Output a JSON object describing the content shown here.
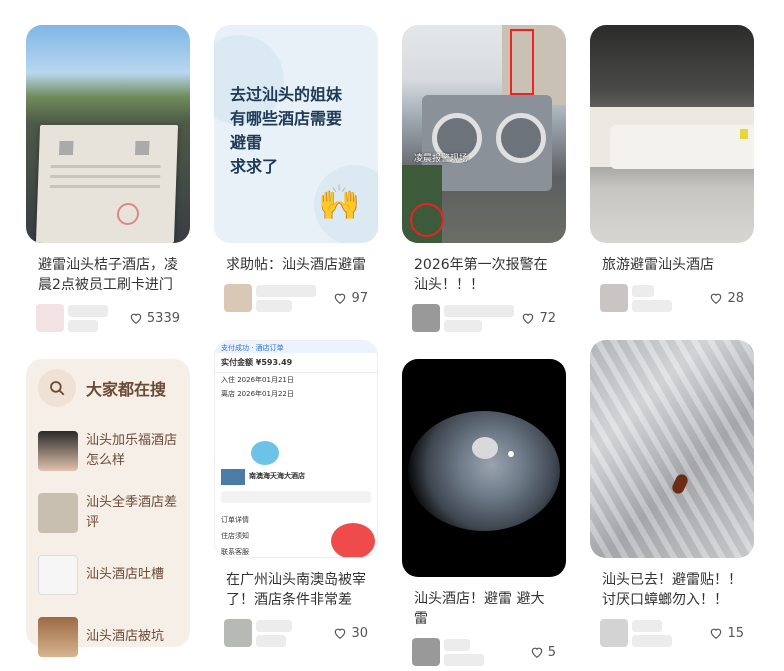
{
  "cards": [
    {
      "title": "避雷汕头桔子酒店，凌晨2点被员工刷卡进门",
      "likes": "5339"
    },
    {
      "title": "求助帖：汕头酒店避雷",
      "likes": "97",
      "image_text": "去过汕头的姐妹\n有哪些酒店需要\n避雷\n求求了"
    },
    {
      "title": "2026年第一次报警在汕头！！！",
      "likes": "72",
      "image_text": "凌晨报警现场"
    },
    {
      "title": "旅游避雷汕头酒店",
      "likes": "28"
    },
    {
      "title": "在广州汕头南澳岛被宰了！酒店条件非常差",
      "likes": "30"
    },
    {
      "title": "汕头酒店！避雷 避大雷",
      "likes": "5"
    },
    {
      "title": "汕头已去！避雷贴！！讨厌口蟑螂勿入！！",
      "likes": "15"
    }
  ],
  "search": {
    "label": "大家都在搜",
    "items": [
      {
        "text": "汕头加乐福酒店怎么样"
      },
      {
        "text": "汕头全季酒店差评"
      },
      {
        "text": "汕头酒店吐槽"
      },
      {
        "text": "汕头酒店被坑"
      }
    ]
  },
  "screenshot": {
    "status": "支付成功 · 酒店订单",
    "amount": "实付金额 ¥593.49",
    "hotel": "南澳海天海大酒店",
    "checkin": "入住 2026年01月21日",
    "checkout": "离店 2026年01月22日",
    "rows": [
      "订单详情",
      "住店须知",
      "联系客服"
    ]
  },
  "colors": {
    "accent": "#ff2442",
    "search_text": "#6b4a35"
  }
}
